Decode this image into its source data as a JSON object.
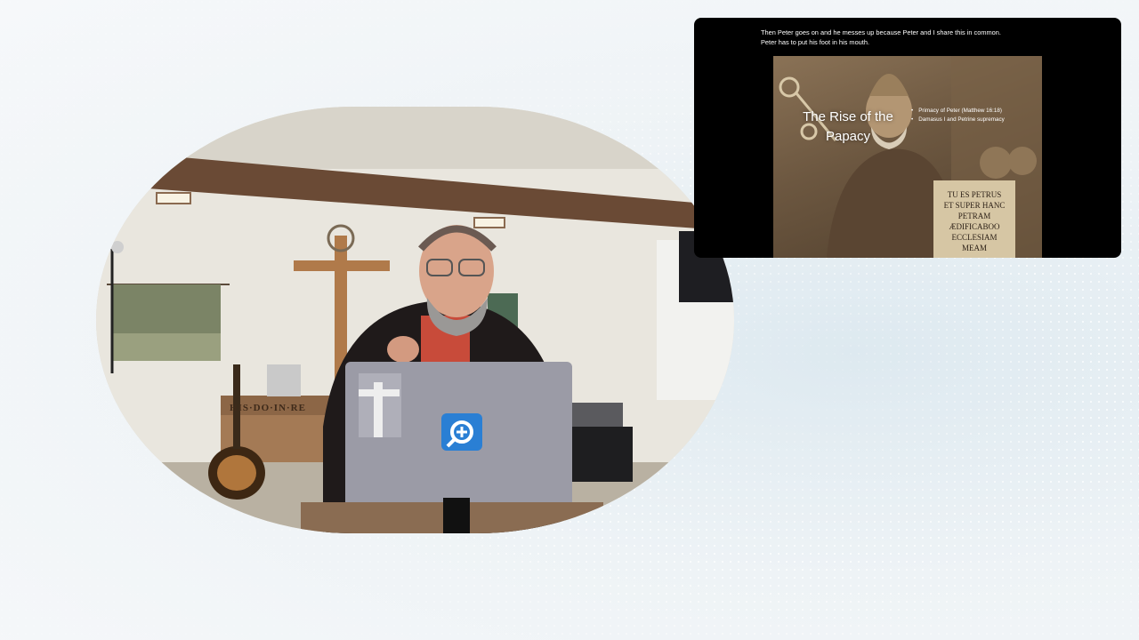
{
  "slide": {
    "caption_line1": "Then Peter goes on and he messes up because Peter and I share this in common.",
    "caption_line2": "Peter has to put his foot in his mouth.",
    "title_line1": "The Rise of the",
    "title_line2": "Papacy",
    "bullets": [
      "Primacy of Peter (Matthew 16:18)",
      "Damasus I and Petrine supremacy"
    ],
    "scroll_lines": [
      "TU ES PETRUS",
      "ET SUPER HANC",
      "PETRAM",
      "ÆDIFICABOO",
      "ECCLESIAM",
      "MEAM"
    ]
  },
  "video": {
    "banner_text": "HIS·DO·IN·RE"
  },
  "colors": {
    "background": "#eef3f6",
    "slide_bg": "#000000",
    "logos_blue": "#2a7fd4",
    "laptop": "#9b9ba6"
  }
}
